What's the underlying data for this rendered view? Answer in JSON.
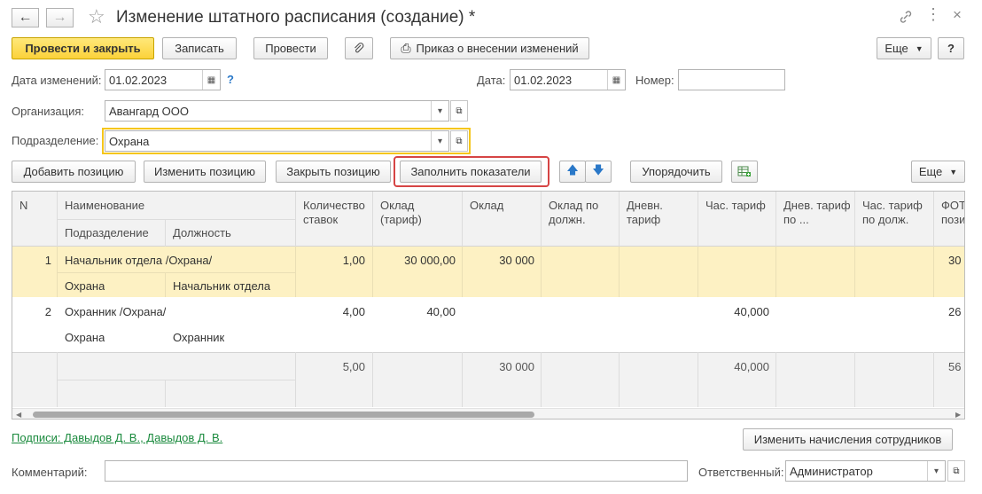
{
  "window": {
    "title": "Изменение штатного расписания (создание) *",
    "back_icon": "arrow-left-icon",
    "forward_icon": "arrow-right-icon",
    "favorite_icon": "star-icon"
  },
  "toolbar": {
    "post_close": "Провести и закрыть",
    "write": "Записать",
    "post": "Провести",
    "order": "Приказ о внесении изменений",
    "more": "Еще",
    "help": "?"
  },
  "form": {
    "change_date_label": "Дата изменений:",
    "change_date_value": "01.02.2023",
    "date_label": "Дата:",
    "date_value": "01.02.2023",
    "number_label": "Номер:",
    "number_value": "",
    "org_label": "Организация:",
    "org_value": "Авангард ООО",
    "dept_label": "Подразделение:",
    "dept_value": "Охрана",
    "help_mark": "?"
  },
  "table_toolbar": {
    "add": "Добавить позицию",
    "edit": "Изменить позицию",
    "close": "Закрыть позицию",
    "fill": "Заполнить показатели",
    "sort": "Упорядочить",
    "more": "Еще"
  },
  "table": {
    "headers": {
      "n": "N",
      "name": "Наименование",
      "dept": "Подразделение",
      "position": "Должность",
      "rates": "Количество ставок",
      "salary_tariff": "Оклад (тариф)",
      "salary": "Оклад",
      "salary_by_pos": "Оклад по должн.",
      "daily_tariff": "Дневн. тариф",
      "hourly_tariff": "Час. тариф",
      "daily_tariff_by": "Днев. тариф по ...",
      "hourly_tariff_by": "Час. тариф по долж.",
      "fot": "ФОТ пози"
    },
    "rows": [
      {
        "n": "1",
        "name": "Начальник отдела /Охрана/",
        "dept": "Охрана",
        "position": "Начальник отдела",
        "rates": "1,00",
        "salary_tariff": "30 000,00",
        "salary": "30 000",
        "hourly_tariff": "",
        "fot": "30"
      },
      {
        "n": "2",
        "name": "Охранник /Охрана/",
        "dept": "Охрана",
        "position": "Охранник",
        "rates": "4,00",
        "salary_tariff": "40,00",
        "salary": "",
        "hourly_tariff": "40,000",
        "fot": "26"
      }
    ],
    "totals": {
      "rates": "5,00",
      "salary": "30 000",
      "hourly_tariff": "40,000",
      "fot": "56"
    }
  },
  "footer": {
    "signatures": "Подписи: Давыдов Д. В., Давыдов Д. В.",
    "change_accruals": "Изменить начисления сотрудников",
    "comment_label": "Комментарий:",
    "comment_value": "",
    "responsible_label": "Ответственный:",
    "responsible_value": "Администратор"
  },
  "colors": {
    "selected_row": "#fdf1c3",
    "primary_button": "#fbd23a",
    "highlight_frame": "#d64545",
    "link": "#1a8a3d"
  }
}
